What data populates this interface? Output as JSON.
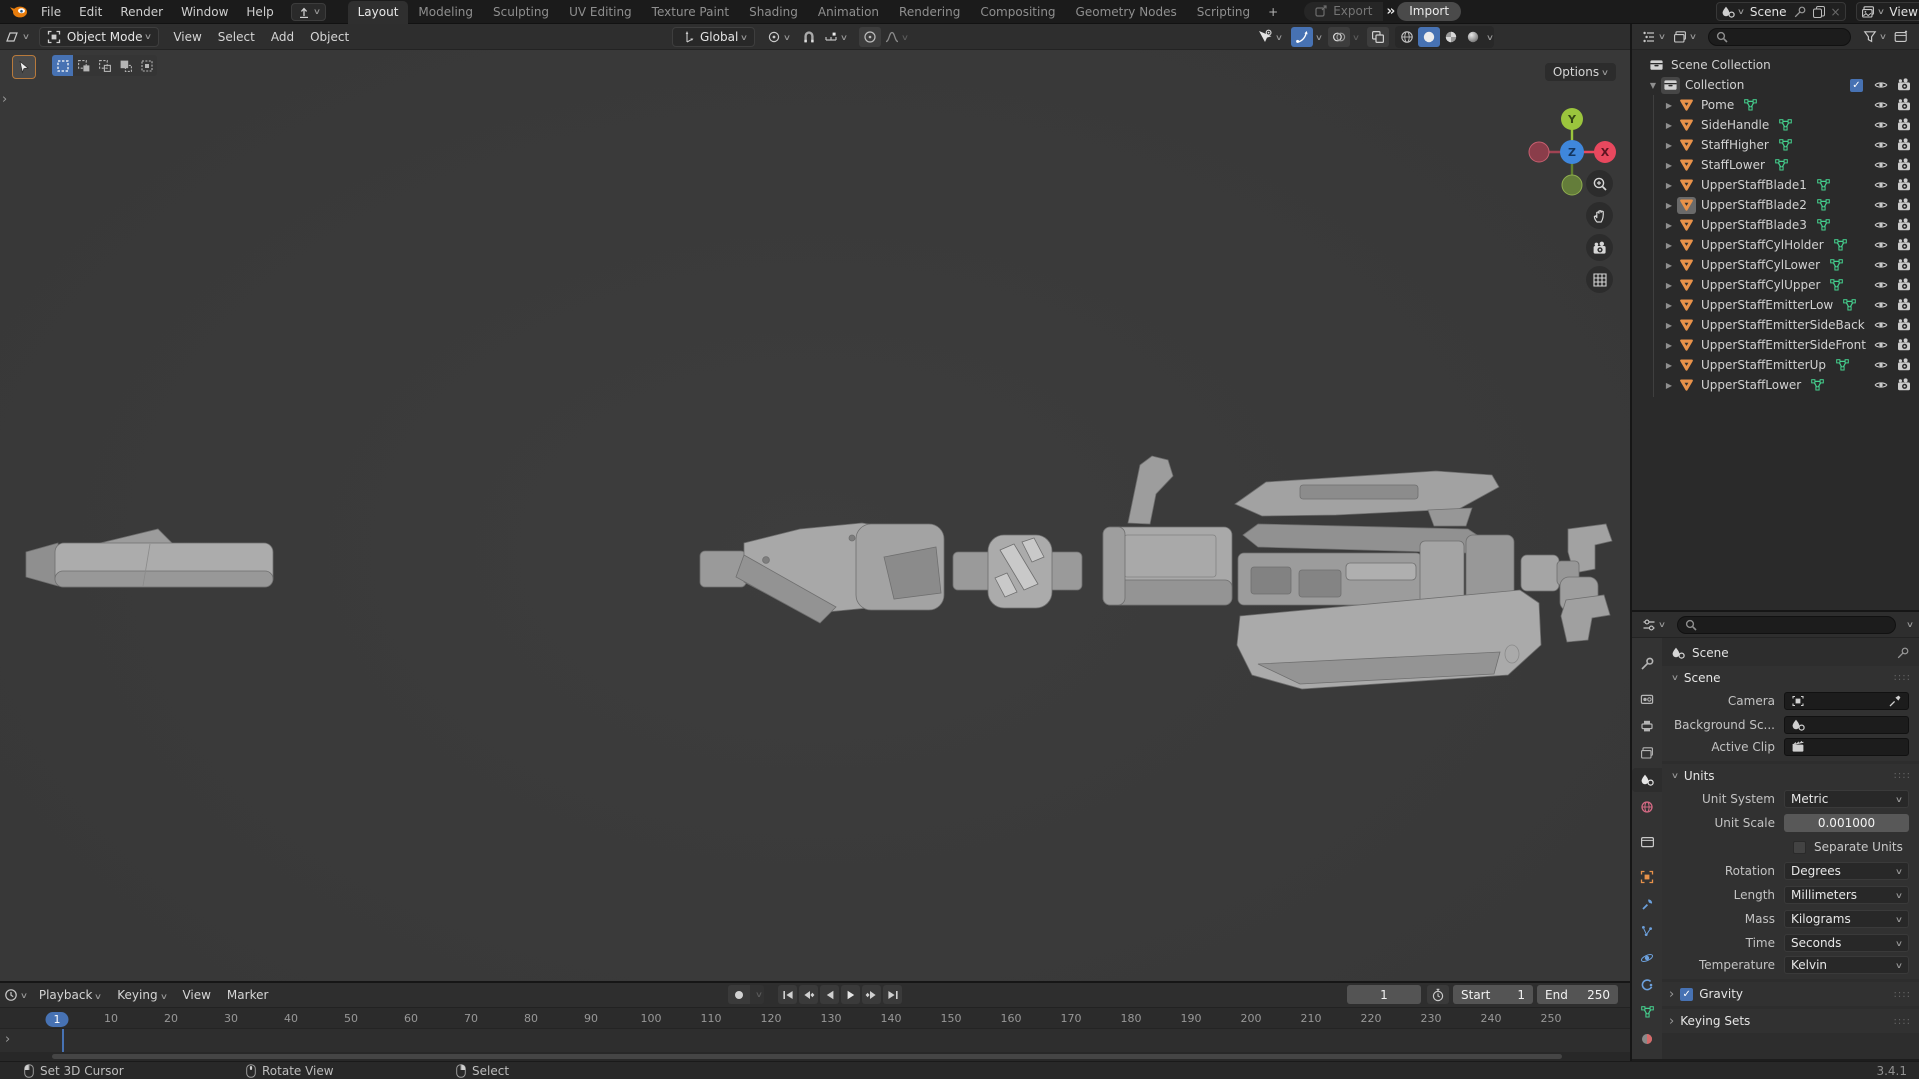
{
  "topbar": {
    "menus": [
      "File",
      "Edit",
      "Render",
      "Window",
      "Help"
    ],
    "workspaces": [
      "Layout",
      "Modeling",
      "Sculpting",
      "UV Editing",
      "Texture Paint",
      "Shading",
      "Animation",
      "Rendering",
      "Compositing",
      "Geometry Nodes",
      "Scripting"
    ],
    "add_tab_label": "+",
    "export_label": "Export",
    "import_label": "Import",
    "scene_selector": {
      "value": "Scene"
    },
    "viewlayer_selector": {
      "value": "ViewLayer"
    }
  },
  "viewport": {
    "header": {
      "mode": "Object Mode",
      "menus": [
        "View",
        "Select",
        "Add",
        "Object"
      ],
      "orientation": "Global"
    },
    "options_label": "Options",
    "gizmo": {
      "x": "X",
      "y": "Y",
      "z": "Z"
    }
  },
  "outliner": {
    "root_collection": "Scene Collection",
    "collection": "Collection",
    "items": [
      {
        "name": "Pome"
      },
      {
        "name": "SideHandle"
      },
      {
        "name": "StaffHigher"
      },
      {
        "name": "StaffLower"
      },
      {
        "name": "UpperStaffBlade1"
      },
      {
        "name": "UpperStaffBlade2",
        "selected": true
      },
      {
        "name": "UpperStaffBlade3"
      },
      {
        "name": "UpperStaffCylHolder"
      },
      {
        "name": "UpperStaffCylLower"
      },
      {
        "name": "UpperStaffCylUpper"
      },
      {
        "name": "UpperStaffEmitterLow"
      },
      {
        "name": "UpperStaffEmitterSideBack",
        "nomesh": true
      },
      {
        "name": "UpperStaffEmitterSideFront",
        "nomesh": true
      },
      {
        "name": "UpperStaffEmitterUp"
      },
      {
        "name": "UpperStaffLower"
      }
    ]
  },
  "properties": {
    "breadcrumb": "Scene",
    "scene_section": {
      "title": "Scene",
      "camera_label": "Camera",
      "background_label": "Background Sc...",
      "clip_label": "Active Clip"
    },
    "units_section": {
      "title": "Units",
      "unit_system": {
        "label": "Unit System",
        "value": "Metric"
      },
      "unit_scale": {
        "label": "Unit Scale",
        "value": "0.001000"
      },
      "separate_units_label": "Separate Units",
      "rotation": {
        "label": "Rotation",
        "value": "Degrees"
      },
      "length": {
        "label": "Length",
        "value": "Millimeters"
      },
      "mass": {
        "label": "Mass",
        "value": "Kilograms"
      },
      "time": {
        "label": "Time",
        "value": "Seconds"
      },
      "temperature": {
        "label": "Temperature",
        "value": "Kelvin"
      }
    },
    "gravity_section": {
      "title": "Gravity"
    },
    "keying_sets_section": {
      "title": "Keying Sets"
    }
  },
  "timeline": {
    "menus": [
      "Playback",
      "Keying",
      "View",
      "Marker"
    ],
    "current_frame": "1",
    "start": {
      "label": "Start",
      "value": "1"
    },
    "end": {
      "label": "End",
      "value": "250"
    },
    "ruler_ticks": [
      1,
      10,
      20,
      30,
      40,
      50,
      60,
      70,
      80,
      90,
      100,
      110,
      120,
      130,
      140,
      150,
      160,
      170,
      180,
      190,
      200,
      210,
      220,
      230,
      240,
      250
    ]
  },
  "statusbar": {
    "hints": [
      {
        "label": "Set 3D Cursor"
      },
      {
        "label": "Rotate View"
      },
      {
        "label": "Select"
      }
    ],
    "version": "3.4.1"
  },
  "colors": {
    "accent_blue": "#4772b3",
    "object_orange": "#e8924a",
    "mesh_green": "#45d18f",
    "axis_x_red": "#e8485e",
    "axis_y_green": "#9bc53d",
    "axis_z_blue": "#3f87dc"
  }
}
